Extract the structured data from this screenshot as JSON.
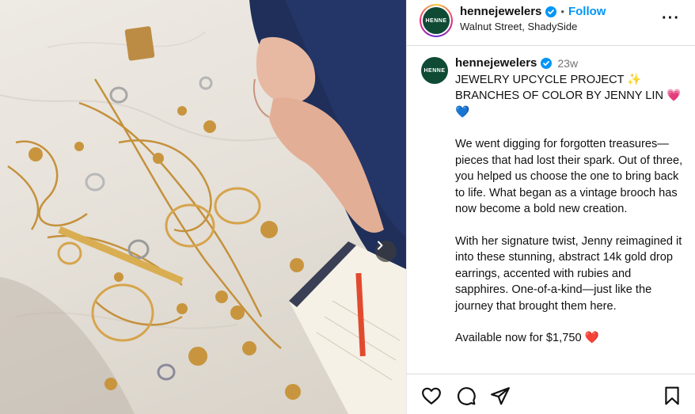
{
  "post": {
    "account": {
      "username": "hennejewelers",
      "avatar_text": "HENNE",
      "location": "Walnut Street, ShadySide",
      "follow_label": "Follow",
      "separator": "•",
      "more_label": "···"
    },
    "caption": {
      "time_ago": "23w",
      "headline": "JEWELRY UPCYCLE PROJECT ✨ BRANCHES OF COLOR BY JENNY LIN 💗 💙",
      "paragraphs": [
        "We went digging for forgotten treasures—pieces that had lost their spark. Out of three, you helped us choose the one to bring back to life. What began as a vintage brooch has now become a bold new creation.",
        "With her signature twist, Jenny reimagined it into these stunning, abstract 14k gold drop earrings, accented with rubies and sapphires. One-of-a-kind—just like the journey that brought them here.",
        "Available now for $1,750 ❤️"
      ]
    },
    "actions": [
      "like-icon",
      "comment-icon",
      "share-icon",
      "save-icon"
    ]
  },
  "colors": {
    "follow": "#0095f6",
    "avatar_bg": "#0f4a35",
    "verified": "#0095f6"
  }
}
